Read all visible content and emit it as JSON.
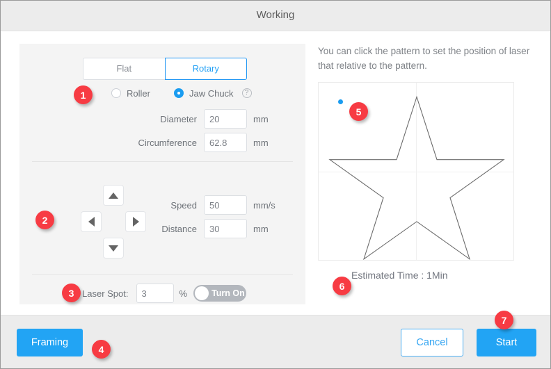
{
  "window": {
    "title": "Working"
  },
  "settings": {
    "mode_tabs": [
      {
        "label": "Flat",
        "active": false
      },
      {
        "label": "Rotary",
        "active": true
      }
    ],
    "rotary_type": {
      "options": [
        {
          "label": "Roller",
          "checked": false
        },
        {
          "label": "Jaw Chuck",
          "checked": true
        }
      ],
      "help_icon": "question-mark-circle-icon",
      "help_glyph": "?"
    },
    "fields": [
      {
        "label": "Diameter",
        "value": "20",
        "unit": "mm"
      },
      {
        "label": "Circumference",
        "value": "62.8",
        "unit": "mm"
      },
      {
        "label": "Speed",
        "value": "50",
        "unit": "mm/s"
      },
      {
        "label": "Distance",
        "value": "30",
        "unit": "mm"
      }
    ],
    "dpad": {
      "up": "arrow-up-icon",
      "down": "arrow-down-icon",
      "left": "arrow-left-icon",
      "right": "arrow-right-icon"
    },
    "laser_spot": {
      "label": "Laser Spot:",
      "value": "3",
      "unit": "%",
      "toggle_label": "Turn On",
      "toggle_state": "off",
      "toggle_color": "#b3b7bd"
    }
  },
  "preview": {
    "hint": "You can click the pattern to set the position of laser that relative to the pattern.",
    "pattern": "star-outline",
    "laser_marker": "laser-position-dot",
    "laser_marker_color": "#1a9cf0",
    "estimated_time_text": "Estimated Time : 1Min"
  },
  "footer": {
    "framing_label": "Framing",
    "cancel_label": "Cancel",
    "start_label": "Start",
    "accent_color": "#22a4f4"
  },
  "callouts": [
    {
      "number": "1"
    },
    {
      "number": "2"
    },
    {
      "number": "3"
    },
    {
      "number": "4"
    },
    {
      "number": "5"
    },
    {
      "number": "6"
    },
    {
      "number": "7"
    }
  ]
}
